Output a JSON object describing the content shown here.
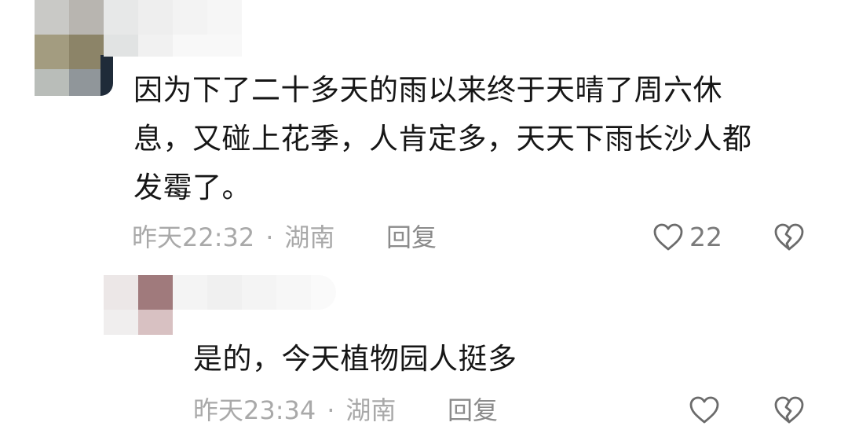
{
  "comments": [
    {
      "text_lines": [
        "因为下了二十多天的雨以来终于天晴了周六休",
        "息，又碰上花季，人肯定多，天天下雨长沙人都",
        "发霉了。"
      ],
      "time": "昨天22:32",
      "separator": "·",
      "location": "湖南",
      "reply_label": "回复",
      "like_count": "22"
    }
  ],
  "replies": [
    {
      "text": "是的，今天植物园人挺多",
      "time": "昨天23:34",
      "separator": "·",
      "location": "湖南",
      "reply_label": "回复",
      "like_count": ""
    }
  ],
  "colors": {
    "text": "#161616",
    "meta": "#a9a9a9",
    "icon": "#6b6b6b"
  },
  "icons": {
    "like": "heart-outline-icon",
    "dislike": "broken-heart-icon"
  }
}
